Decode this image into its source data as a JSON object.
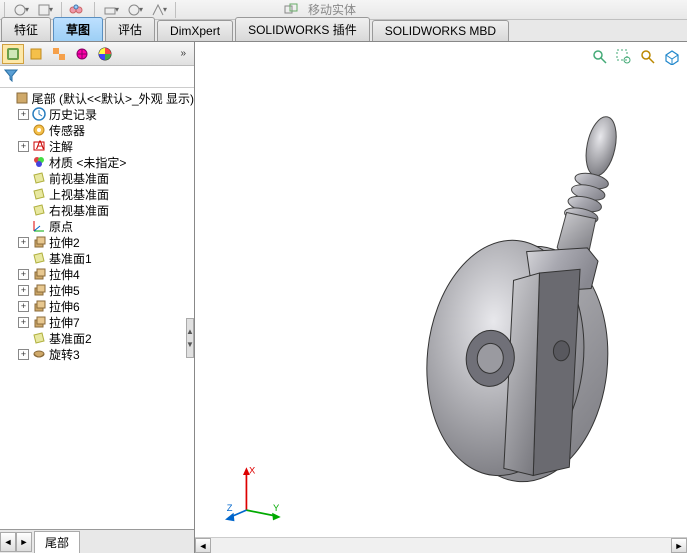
{
  "top": {
    "move_label": "移动实体"
  },
  "tabs": [
    {
      "label": "特征",
      "active": false
    },
    {
      "label": "草图",
      "active": true
    },
    {
      "label": "评估",
      "active": false
    },
    {
      "label": "DimXpert",
      "active": false
    },
    {
      "label": "SOLIDWORKS 插件",
      "active": false
    },
    {
      "label": "SOLIDWORKS MBD",
      "active": false
    }
  ],
  "tree_root": "尾部  (默认<<默认>_外观 显示)",
  "tree": [
    {
      "icon": "history",
      "label": "历史记录",
      "exp": "+"
    },
    {
      "icon": "sensor",
      "label": "传感器",
      "exp": ""
    },
    {
      "icon": "annot",
      "label": "注解",
      "exp": "+"
    },
    {
      "icon": "material",
      "label": "材质 <未指定>",
      "exp": ""
    },
    {
      "icon": "plane",
      "label": "前视基准面",
      "exp": ""
    },
    {
      "icon": "plane",
      "label": "上视基准面",
      "exp": ""
    },
    {
      "icon": "plane",
      "label": "右视基准面",
      "exp": ""
    },
    {
      "icon": "origin",
      "label": "原点",
      "exp": ""
    },
    {
      "icon": "extrude",
      "label": "拉伸2",
      "exp": "+"
    },
    {
      "icon": "plane",
      "label": "基准面1",
      "exp": ""
    },
    {
      "icon": "extrude",
      "label": "拉伸4",
      "exp": "+"
    },
    {
      "icon": "extrude",
      "label": "拉伸5",
      "exp": "+"
    },
    {
      "icon": "extrude",
      "label": "拉伸6",
      "exp": "+"
    },
    {
      "icon": "extrude",
      "label": "拉伸7",
      "exp": "+"
    },
    {
      "icon": "plane",
      "label": "基准面2",
      "exp": ""
    },
    {
      "icon": "revolve",
      "label": "旋转3",
      "exp": "+"
    }
  ],
  "bottom_tab": "尾部",
  "triad": {
    "x": "X",
    "y": "Y",
    "z": "Z"
  }
}
